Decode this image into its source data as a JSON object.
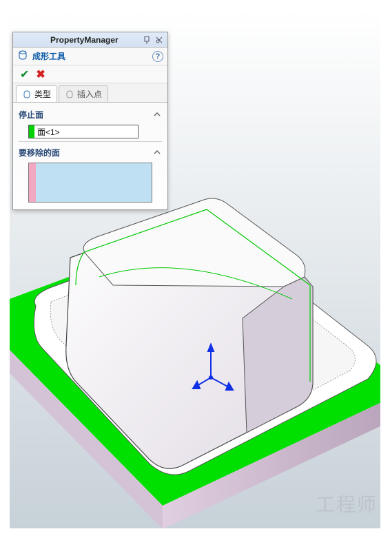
{
  "toolbar": {
    "icons": [
      "zoom-icon",
      "zoom-fit-icon",
      "zoom-window-icon",
      "pan-icon",
      "rotate-icon",
      "sep",
      "edit-icon",
      "box-icon",
      "box2-icon",
      "box3-icon",
      "sep",
      "cube-icon",
      "eye-icon",
      "sep",
      "grid-icon",
      "window-icon",
      "monitor-icon"
    ]
  },
  "panel": {
    "title": "PropertyManager",
    "feature": {
      "label": "成形工具"
    },
    "tabs": [
      {
        "id": "type",
        "label": "类型",
        "active": true
      },
      {
        "id": "insert",
        "label": "插入点",
        "active": false
      }
    ],
    "sections": {
      "stop": {
        "title": "停止面",
        "value": "面<1>"
      },
      "remove": {
        "title": "要移除的面"
      }
    }
  },
  "watermark": "工程师"
}
